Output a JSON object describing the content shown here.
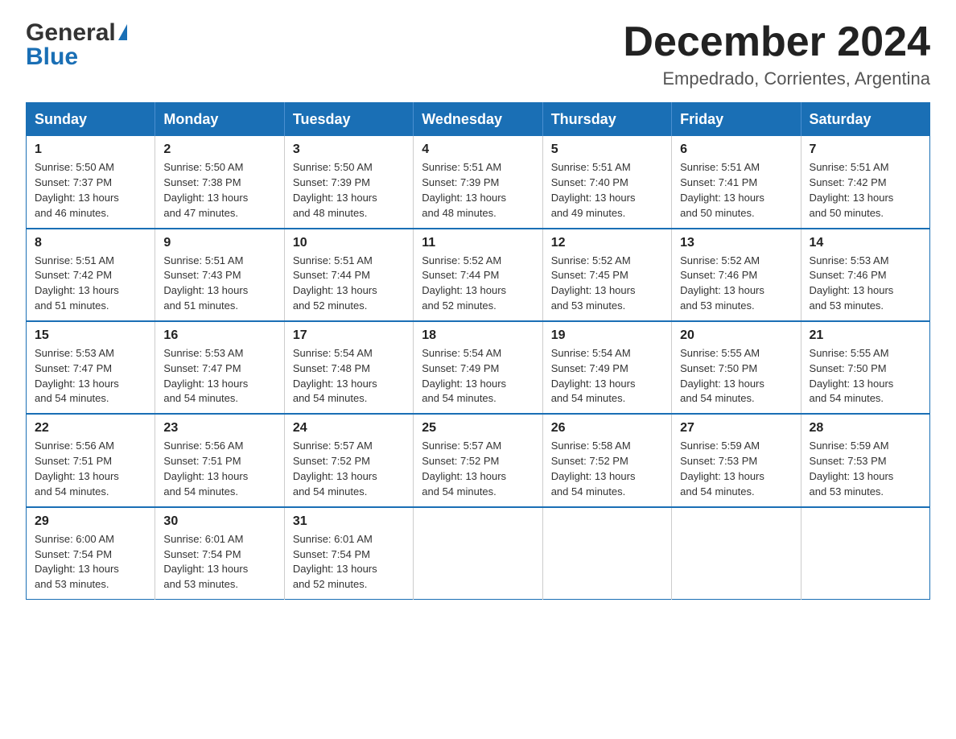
{
  "header": {
    "logo_general": "General",
    "logo_blue": "Blue",
    "month_title": "December 2024",
    "location": "Empedrado, Corrientes, Argentina"
  },
  "days_of_week": [
    "Sunday",
    "Monday",
    "Tuesday",
    "Wednesday",
    "Thursday",
    "Friday",
    "Saturday"
  ],
  "weeks": [
    [
      {
        "day": "1",
        "sunrise": "5:50 AM",
        "sunset": "7:37 PM",
        "daylight": "13 hours and 46 minutes."
      },
      {
        "day": "2",
        "sunrise": "5:50 AM",
        "sunset": "7:38 PM",
        "daylight": "13 hours and 47 minutes."
      },
      {
        "day": "3",
        "sunrise": "5:50 AM",
        "sunset": "7:39 PM",
        "daylight": "13 hours and 48 minutes."
      },
      {
        "day": "4",
        "sunrise": "5:51 AM",
        "sunset": "7:39 PM",
        "daylight": "13 hours and 48 minutes."
      },
      {
        "day": "5",
        "sunrise": "5:51 AM",
        "sunset": "7:40 PM",
        "daylight": "13 hours and 49 minutes."
      },
      {
        "day": "6",
        "sunrise": "5:51 AM",
        "sunset": "7:41 PM",
        "daylight": "13 hours and 50 minutes."
      },
      {
        "day": "7",
        "sunrise": "5:51 AM",
        "sunset": "7:42 PM",
        "daylight": "13 hours and 50 minutes."
      }
    ],
    [
      {
        "day": "8",
        "sunrise": "5:51 AM",
        "sunset": "7:42 PM",
        "daylight": "13 hours and 51 minutes."
      },
      {
        "day": "9",
        "sunrise": "5:51 AM",
        "sunset": "7:43 PM",
        "daylight": "13 hours and 51 minutes."
      },
      {
        "day": "10",
        "sunrise": "5:51 AM",
        "sunset": "7:44 PM",
        "daylight": "13 hours and 52 minutes."
      },
      {
        "day": "11",
        "sunrise": "5:52 AM",
        "sunset": "7:44 PM",
        "daylight": "13 hours and 52 minutes."
      },
      {
        "day": "12",
        "sunrise": "5:52 AM",
        "sunset": "7:45 PM",
        "daylight": "13 hours and 53 minutes."
      },
      {
        "day": "13",
        "sunrise": "5:52 AM",
        "sunset": "7:46 PM",
        "daylight": "13 hours and 53 minutes."
      },
      {
        "day": "14",
        "sunrise": "5:53 AM",
        "sunset": "7:46 PM",
        "daylight": "13 hours and 53 minutes."
      }
    ],
    [
      {
        "day": "15",
        "sunrise": "5:53 AM",
        "sunset": "7:47 PM",
        "daylight": "13 hours and 54 minutes."
      },
      {
        "day": "16",
        "sunrise": "5:53 AM",
        "sunset": "7:47 PM",
        "daylight": "13 hours and 54 minutes."
      },
      {
        "day": "17",
        "sunrise": "5:54 AM",
        "sunset": "7:48 PM",
        "daylight": "13 hours and 54 minutes."
      },
      {
        "day": "18",
        "sunrise": "5:54 AM",
        "sunset": "7:49 PM",
        "daylight": "13 hours and 54 minutes."
      },
      {
        "day": "19",
        "sunrise": "5:54 AM",
        "sunset": "7:49 PM",
        "daylight": "13 hours and 54 minutes."
      },
      {
        "day": "20",
        "sunrise": "5:55 AM",
        "sunset": "7:50 PM",
        "daylight": "13 hours and 54 minutes."
      },
      {
        "day": "21",
        "sunrise": "5:55 AM",
        "sunset": "7:50 PM",
        "daylight": "13 hours and 54 minutes."
      }
    ],
    [
      {
        "day": "22",
        "sunrise": "5:56 AM",
        "sunset": "7:51 PM",
        "daylight": "13 hours and 54 minutes."
      },
      {
        "day": "23",
        "sunrise": "5:56 AM",
        "sunset": "7:51 PM",
        "daylight": "13 hours and 54 minutes."
      },
      {
        "day": "24",
        "sunrise": "5:57 AM",
        "sunset": "7:52 PM",
        "daylight": "13 hours and 54 minutes."
      },
      {
        "day": "25",
        "sunrise": "5:57 AM",
        "sunset": "7:52 PM",
        "daylight": "13 hours and 54 minutes."
      },
      {
        "day": "26",
        "sunrise": "5:58 AM",
        "sunset": "7:52 PM",
        "daylight": "13 hours and 54 minutes."
      },
      {
        "day": "27",
        "sunrise": "5:59 AM",
        "sunset": "7:53 PM",
        "daylight": "13 hours and 54 minutes."
      },
      {
        "day": "28",
        "sunrise": "5:59 AM",
        "sunset": "7:53 PM",
        "daylight": "13 hours and 53 minutes."
      }
    ],
    [
      {
        "day": "29",
        "sunrise": "6:00 AM",
        "sunset": "7:54 PM",
        "daylight": "13 hours and 53 minutes."
      },
      {
        "day": "30",
        "sunrise": "6:01 AM",
        "sunset": "7:54 PM",
        "daylight": "13 hours and 53 minutes."
      },
      {
        "day": "31",
        "sunrise": "6:01 AM",
        "sunset": "7:54 PM",
        "daylight": "13 hours and 52 minutes."
      },
      null,
      null,
      null,
      null
    ]
  ],
  "cell_labels": {
    "sunrise": "Sunrise:",
    "sunset": "Sunset:",
    "daylight": "Daylight:"
  }
}
